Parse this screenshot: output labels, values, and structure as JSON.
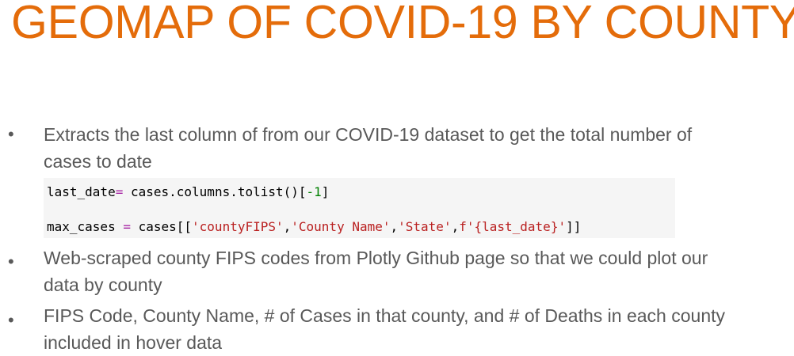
{
  "slide": {
    "title": "GEOMAP OF COVID-19 BY COUNTY",
    "bullet_glyph": "•",
    "bullets": [
      {
        "line1": "Extracts the last column of from our COVID-19 dataset to get the total number of",
        "line2": "cases to date"
      },
      {
        "line1": "Web-scraped county FIPS codes from Plotly Github page so that we could plot our",
        "line2": "data by county"
      },
      {
        "line1": "FIPS Code, County Name, # of Cases in that county, and # of Deaths in each county",
        "line2": "included in hover data"
      }
    ],
    "code": {
      "line1": {
        "var": "last_date",
        "op": "=",
        "expr": " cases.columns.tolist()[",
        "index": "-1",
        "close": "]"
      },
      "line2": {
        "var": "max_cases ",
        "op": "=",
        "expr": " cases[[",
        "s1": "'countyFIPS'",
        "c1": ",",
        "s2": "'County Name'",
        "c2": ",",
        "s3": "'State'",
        "c3": ",",
        "s4": "f'{last_date}'",
        "close": "]]"
      }
    }
  }
}
